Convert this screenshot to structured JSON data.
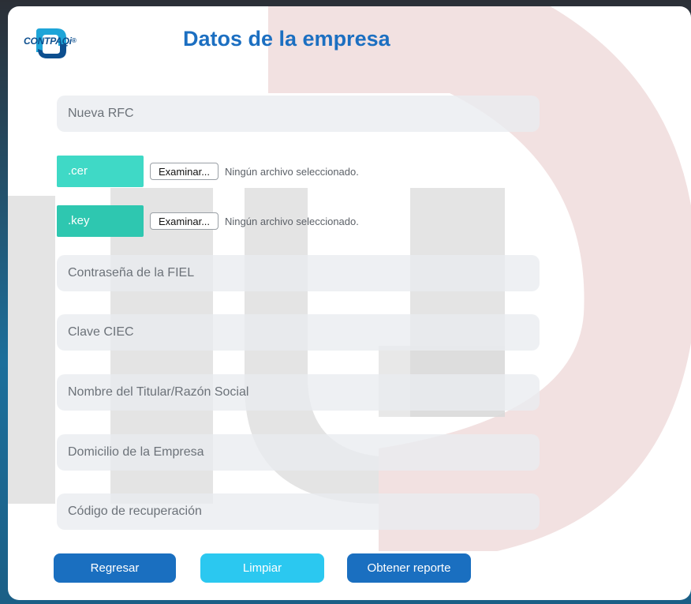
{
  "header": {
    "logo_text": "CONTPAQ",
    "logo_suffix": "i",
    "logo_reg": "®",
    "title": "Datos de la empresa"
  },
  "form": {
    "rfc_placeholder": "Nueva RFC",
    "cer": {
      "tag": ".cer",
      "button_label": "Examinar...",
      "status": "Ningún archivo seleccionado."
    },
    "key": {
      "tag": ".key",
      "button_label": "Examinar...",
      "status": "Ningún archivo seleccionado."
    },
    "fiel_password_placeholder": "Contraseña de la FIEL",
    "ciec_placeholder": "Clave CIEC",
    "owner_name_placeholder": "Nombre del Titular/Razón Social",
    "address_placeholder": "Domicilio de la Empresa",
    "recovery_code_placeholder": "Código de recuperación"
  },
  "actions": {
    "back_label": "Regresar",
    "clear_label": "Limpiar",
    "report_label": "Obtener reporte"
  },
  "colors": {
    "title": "#1c6fc1",
    "cer_tag": "#3fd9c6",
    "key_tag": "#2ec7b0",
    "back_button": "#1a6fc0",
    "clear_button": "#2bc8f0",
    "report_button": "#1a6fc0"
  }
}
